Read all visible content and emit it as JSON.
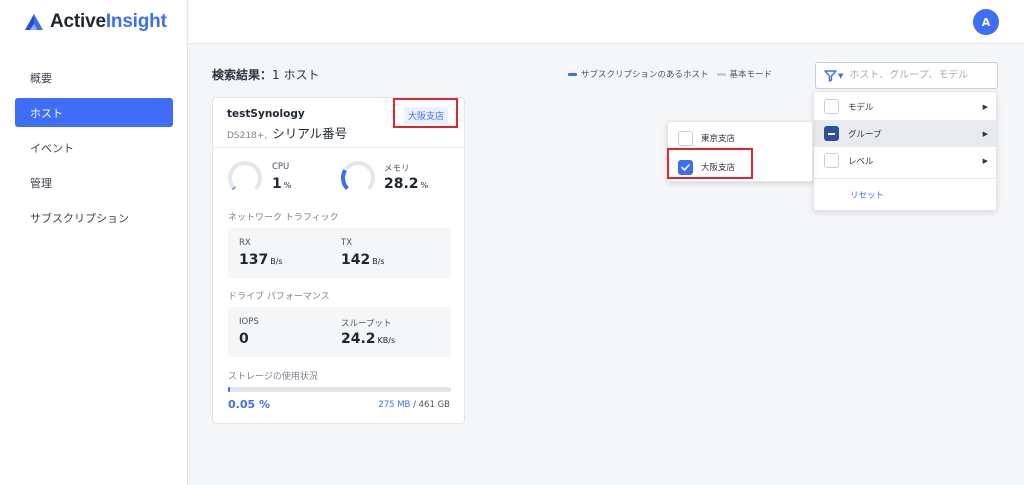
{
  "app": {
    "logo_plain": "Active",
    "logo_accent": "Insight"
  },
  "header": {
    "avatar_letter": "A"
  },
  "sidebar": {
    "items": [
      {
        "label": "概要"
      },
      {
        "label": "ホスト"
      },
      {
        "label": "イベント"
      },
      {
        "label": "管理"
      },
      {
        "label": "サブスクリプション"
      }
    ],
    "active_index": 1
  },
  "results": {
    "title": "検索結果：",
    "count": "1 ホスト"
  },
  "legend": {
    "subscribed": "サブスクリプションのあるホスト",
    "basic": "基本モード"
  },
  "search": {
    "placeholder": "ホスト、グループ、モデル"
  },
  "card": {
    "name": "testSynology",
    "model": "DS218+,",
    "serial": "シリアル番号",
    "tag": "大阪支店",
    "cpu_label": "CPU",
    "cpu_value": "1",
    "cpu_unit": "%",
    "cpu_fraction": 0.01,
    "mem_label": "メモリ",
    "mem_value": "28.2",
    "mem_unit": "%",
    "mem_fraction": 0.282,
    "network_title": "ネットワーク トラフィック",
    "rx_label": "RX",
    "rx_value": "137",
    "rx_unit": "B/s",
    "tx_label": "TX",
    "tx_value": "142",
    "tx_unit": "B/s",
    "drive_title": "ドライブ パフォーマンス",
    "iops_label": "IOPS",
    "iops_value": "0",
    "throughput_label": "スループット",
    "throughput_value": "24.2",
    "throughput_unit": "KB/s",
    "storage_title": "ストレージの使用状況",
    "storage_pct": "0.05 %",
    "storage_fraction": 0.0005,
    "storage_used": "275 MB",
    "storage_total": " / 461 GB"
  },
  "filter_menu": {
    "items": [
      {
        "label": "モデル",
        "state": "unchecked"
      },
      {
        "label": "グループ",
        "state": "indeterminate"
      },
      {
        "label": "レベル",
        "state": "unchecked"
      }
    ],
    "reset_label": "リセット"
  },
  "group_submenu": {
    "items": [
      {
        "label": "東京支店",
        "checked": false
      },
      {
        "label": "大阪支店",
        "checked": true
      }
    ]
  },
  "colors": {
    "accent": "#3d6ef5",
    "highlight_frame": "#e0262a",
    "group_indeterminate": "#2f4f9e"
  }
}
